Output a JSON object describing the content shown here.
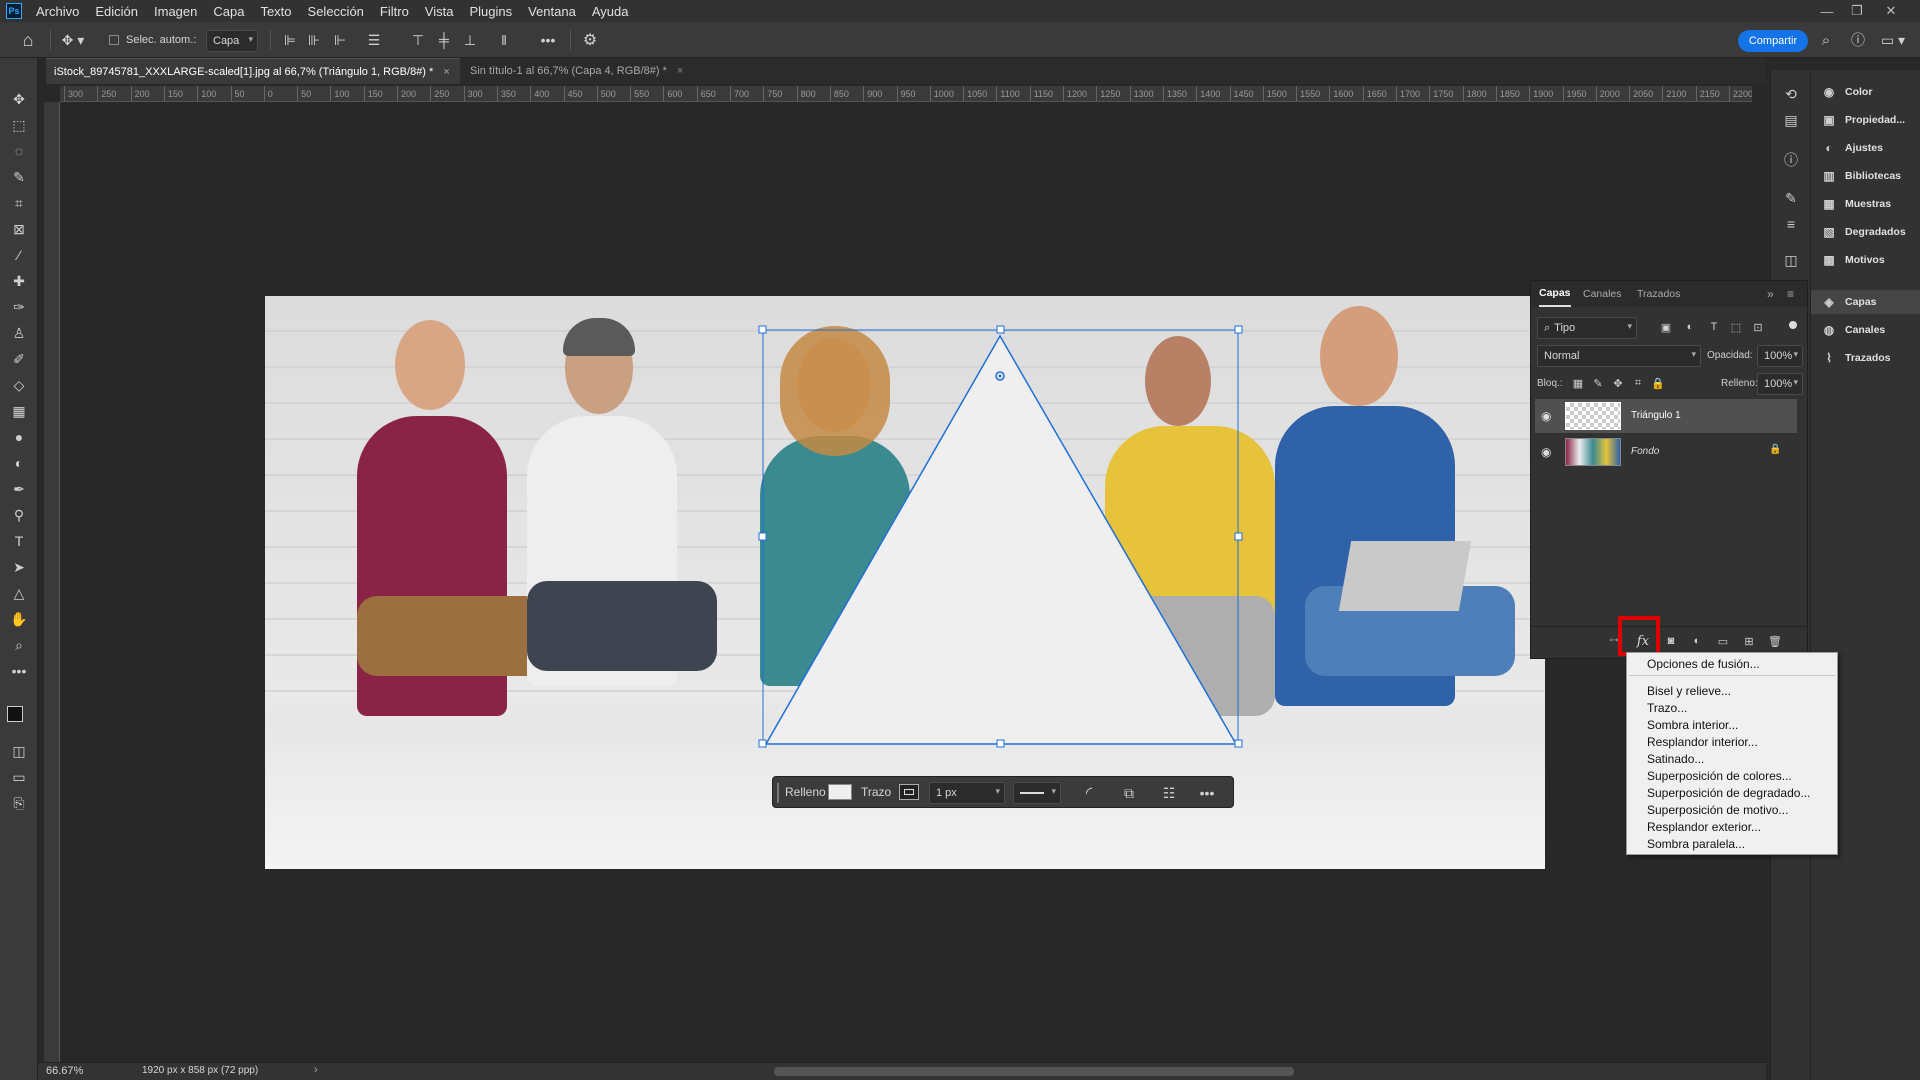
{
  "menu": {
    "logo": "Ps",
    "items": [
      "Archivo",
      "Edición",
      "Imagen",
      "Capa",
      "Texto",
      "Selección",
      "Filtro",
      "Vista",
      "Plugins",
      "Ventana",
      "Ayuda"
    ]
  },
  "options_bar": {
    "auto_select_label": "Selec. autom.:",
    "auto_select_value": "Capa",
    "share_label": "Compartir"
  },
  "tabs": [
    {
      "label": "iStock_89745781_XXXLARGE-scaled[1].jpg al 66,7% (Triángulo 1, RGB/8#) *",
      "active": true
    },
    {
      "label": "Sin título-1 al 66,7% (Capa 4, RGB/8#) *",
      "active": false
    }
  ],
  "ruler_ticks": [
    "300",
    "250",
    "200",
    "150",
    "100",
    "50",
    "0",
    "50",
    "100",
    "150",
    "200",
    "250",
    "300",
    "350",
    "400",
    "450",
    "500",
    "550",
    "600",
    "650",
    "700",
    "750",
    "800",
    "850",
    "900",
    "950",
    "1000",
    "1050",
    "1100",
    "1150",
    "1200",
    "1250",
    "1300",
    "1350",
    "1400",
    "1450",
    "1500",
    "1550",
    "1600",
    "1650",
    "1700",
    "1750",
    "1800",
    "1850",
    "1900",
    "1950",
    "2000",
    "2050",
    "2100",
    "2150",
    "2200"
  ],
  "shape_props": {
    "fill_label": "Relleno",
    "stroke_label": "Trazo",
    "stroke_width": "1 px"
  },
  "status": {
    "zoom": "66.67%",
    "doc_info": "1920 px x 858 px (72 ppp)"
  },
  "right_panel": {
    "items": [
      "Color",
      "Propiedad...",
      "Ajustes",
      "Bibliotecas",
      "Muestras",
      "Degradados",
      "Motivos",
      "Capas",
      "Canales",
      "Trazados"
    ]
  },
  "layers_panel": {
    "tabs": [
      "Capas",
      "Canales",
      "Trazados"
    ],
    "filter_label": "Tipo",
    "blend_mode": "Normal",
    "opacity_label": "Opacidad:",
    "opacity_value": "100%",
    "lock_label": "Bloq.:",
    "fill_label": "Relleno:",
    "fill_value": "100%",
    "layers": [
      {
        "name": "Triángulo 1",
        "selected": true
      },
      {
        "name": "Fondo",
        "selected": false
      }
    ],
    "fx_label": "fx"
  },
  "context_menu": {
    "items": [
      "Opciones de fusión...",
      "Bisel y relieve...",
      "Trazo...",
      "Sombra interior...",
      "Resplandor interior...",
      "Satinado...",
      "Superposición de colores...",
      "Superposición de degradado...",
      "Superposición de motivo...",
      "Resplandor exterior...",
      "Sombra paralela..."
    ]
  },
  "colors": {
    "accent": "#1473e6",
    "highlight": "#e00000",
    "selection": "#1f6fd6"
  }
}
